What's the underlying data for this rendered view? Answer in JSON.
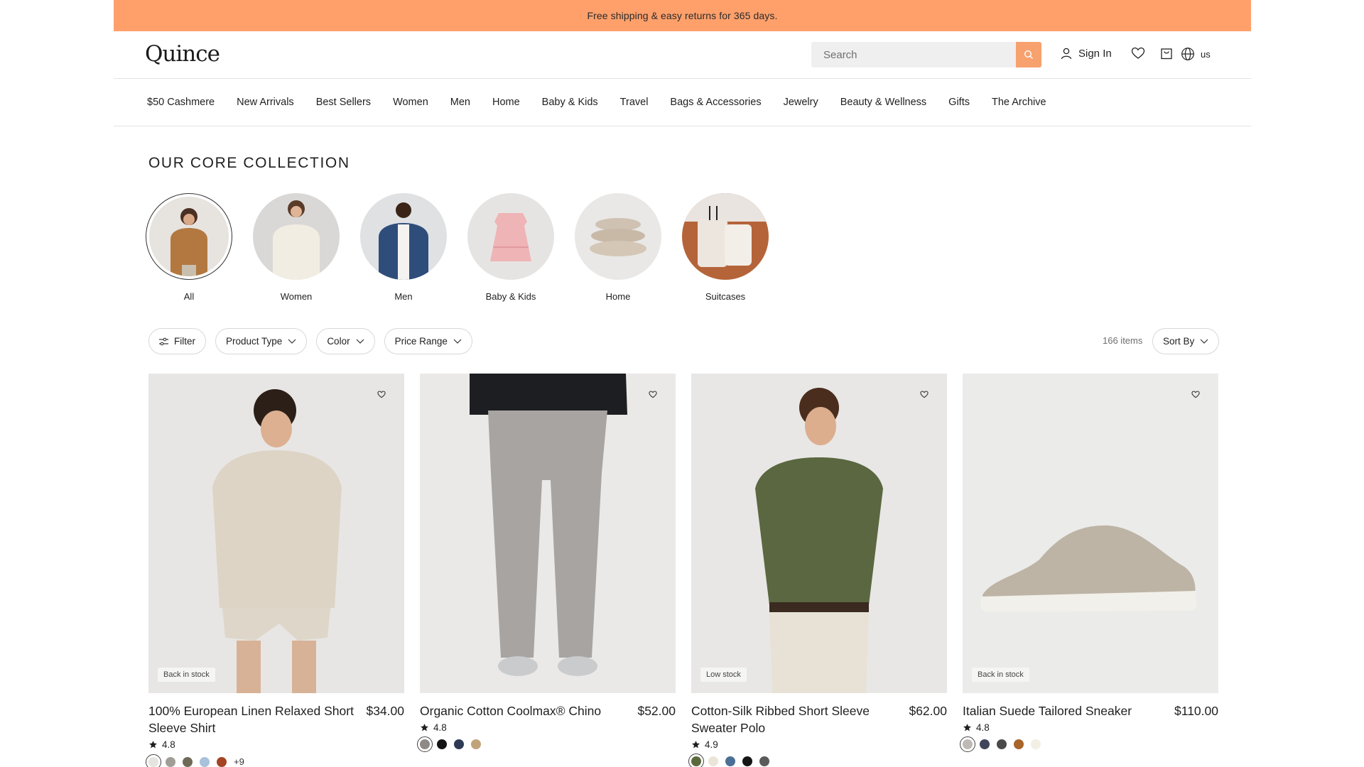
{
  "promo": {
    "text": "Free shipping & easy returns for 365 days."
  },
  "header": {
    "logo": "Quince",
    "search_placeholder": "Search",
    "sign_in": "Sign In",
    "region": "us"
  },
  "nav": [
    "$50 Cashmere",
    "New Arrivals",
    "Best Sellers",
    "Women",
    "Men",
    "Home",
    "Baby & Kids",
    "Travel",
    "Bags & Accessories",
    "Jewelry",
    "Beauty & Wellness",
    "Gifts",
    "The Archive"
  ],
  "collection": {
    "title": "OUR CORE COLLECTION",
    "categories": [
      {
        "label": "All",
        "active": true
      },
      {
        "label": "Women"
      },
      {
        "label": "Men"
      },
      {
        "label": "Baby & Kids"
      },
      {
        "label": "Home"
      },
      {
        "label": "Suitcases"
      }
    ]
  },
  "filters": {
    "filter": "Filter",
    "product_type": "Product Type",
    "color": "Color",
    "price_range": "Price Range",
    "item_count": "166 items",
    "sort_by": "Sort By"
  },
  "products": [
    {
      "name": "100% European Linen Relaxed Short Sleeve Shirt",
      "price": "$34.00",
      "rating": "4.8",
      "badge": "Back in stock",
      "swatches": [
        "#e6e4e0",
        "#a19e98",
        "#6f6a58",
        "#a9c2dc",
        "#a44424"
      ],
      "more": "+9"
    },
    {
      "name": "Organic Cotton Coolmax® Chino",
      "price": "$52.00",
      "rating": "4.8",
      "badge": "",
      "swatches": [
        "#8f8a85",
        "#141414",
        "#2e3a55",
        "#c1a37a"
      ],
      "more": ""
    },
    {
      "name": "Cotton-Silk Ribbed Short Sleeve Sweater Polo",
      "price": "$62.00",
      "rating": "4.9",
      "badge": "Low stock",
      "swatches": [
        "#5b6a3c",
        "#ebe5d8",
        "#4c6f95",
        "#151515",
        "#5a5a5a"
      ],
      "more": ""
    },
    {
      "name": "Italian Suede Tailored Sneaker",
      "price": "$110.00",
      "rating": "4.8",
      "badge": "Back in stock",
      "swatches": [
        "#bdbab5",
        "#3f465c",
        "#4a4a4c",
        "#a8642a",
        "#f3efe4"
      ],
      "more": ""
    }
  ],
  "colors": {
    "promo_bar": "#ffa06b",
    "search_button": "#f7a16f"
  }
}
